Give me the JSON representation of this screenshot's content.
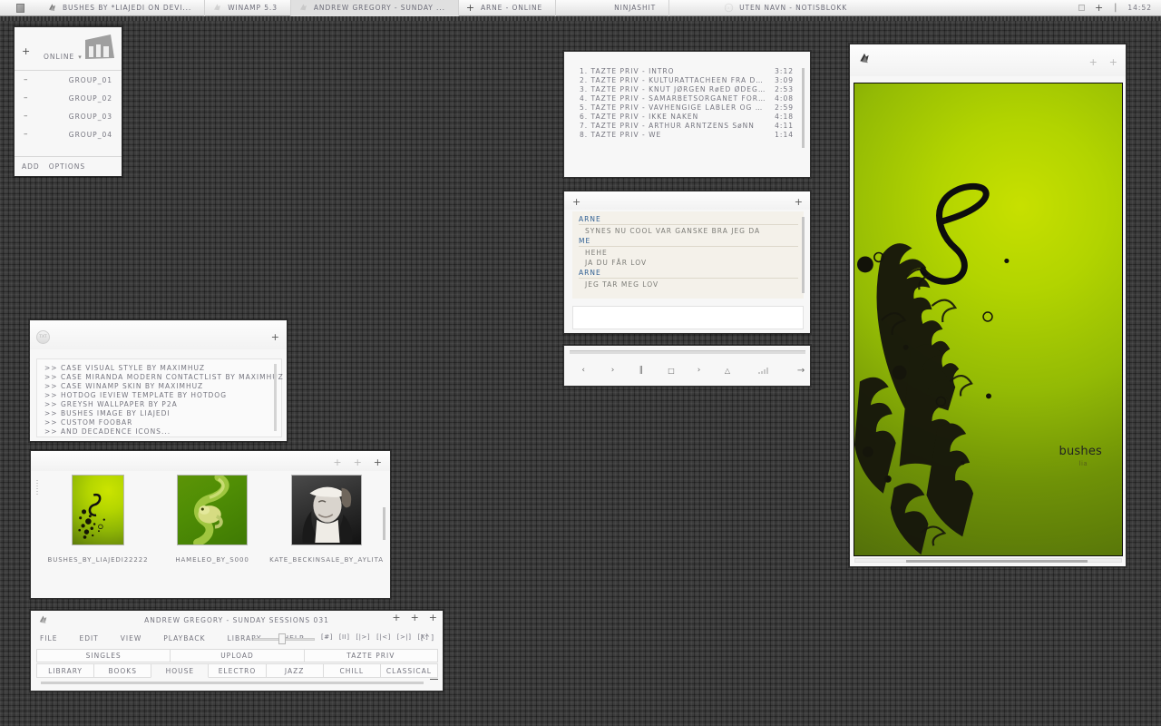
{
  "taskbar": {
    "start_icon": "start-square-icon",
    "items": [
      {
        "label": "BUSHES BY *LIAJEDI ON DEVI...",
        "icon": "foobar-icon",
        "active": false
      },
      {
        "label": "WINAMP 5.3",
        "icon": "foobar-icon",
        "active": false
      },
      {
        "label": "ANDREW GREGORY - SUNDAY ...",
        "icon": "foobar-icon",
        "active": true
      },
      {
        "label": "ARNE - ONLINE",
        "icon": "plus-icon",
        "active": false
      },
      {
        "label": "NINJASHIT",
        "icon": "none",
        "active": false
      },
      {
        "label": "UTEN NAVN - NOTISBLOKK",
        "icon": "notepad-icon",
        "active": false
      }
    ],
    "tray": {
      "box": "tray-box-icon",
      "plus": "+",
      "bar": "|",
      "clock": "14:52"
    }
  },
  "contactlist": {
    "add_icon": "+",
    "status": "ONLINE",
    "status_chevron": "chevron-down-icon",
    "avatar": "contact-avatar",
    "groups": [
      {
        "collapse": "–",
        "label": "GROUP_01"
      },
      {
        "collapse": "–",
        "label": "GROUP_02"
      },
      {
        "collapse": "–",
        "label": "GROUP_03"
      },
      {
        "collapse": "–",
        "label": "GROUP_04"
      }
    ],
    "footer": {
      "add": "ADD",
      "options": "OPTIONS"
    }
  },
  "playlist": {
    "tracks": [
      {
        "n": "1.",
        "title": "TAZTE PRIV - INTRO",
        "dur": "3:12"
      },
      {
        "n": "2.",
        "title": "TAZTE PRIV - KULTURATTACHEEN FRA DEN DANSKE ...",
        "dur": "3:09"
      },
      {
        "n": "3.",
        "title": "TAZTE PRIV - KNUT JØRGEN RøED ØDEGAARD",
        "dur": "2:53"
      },
      {
        "n": "4.",
        "title": "TAZTE PRIV - SAMARBETSORGANET FOR INVANDRAR...",
        "dur": "4:08"
      },
      {
        "n": "5.",
        "title": "TAZTE PRIV - VAVHENGIGE LABLER OG PLATESELSK...",
        "dur": "2:59"
      },
      {
        "n": "6.",
        "title": "TAZTE PRIV - IKKE NAKEN",
        "dur": "4:18"
      },
      {
        "n": "7.",
        "title": "TAZTE PRIV - ARTHUR ARNTZENS SøNN",
        "dur": "4:11"
      },
      {
        "n": "8.",
        "title": "TAZTE PRIV - WE",
        "dur": "1:14"
      }
    ]
  },
  "chat": {
    "left_plus": "+",
    "right_plus": "+",
    "messages": [
      {
        "nick": "ARNE",
        "lines": [
          "SYNES NU COOL VAR GANSKE BRA JEG DA"
        ]
      },
      {
        "nick": "ME",
        "lines": [
          "HEHE",
          "JA DU FÅR LOV"
        ]
      },
      {
        "nick": "ARNE",
        "lines": [
          "JEG TAR MEG LOV"
        ]
      }
    ],
    "input_value": "",
    "input_placeholder": ""
  },
  "transport": {
    "buttons": [
      {
        "glyph": "‹",
        "name": "previous-button"
      },
      {
        "glyph": "›",
        "name": "next-button"
      },
      {
        "glyph": "‖",
        "name": "pause-button"
      },
      {
        "glyph": "□",
        "name": "stop-button"
      },
      {
        "glyph": "›",
        "name": "play-button"
      },
      {
        "glyph": "△",
        "name": "eject-button"
      }
    ],
    "volume_label": "volume-meter",
    "arrow": "→"
  },
  "notepad": {
    "badge": "TXT",
    "plus": "+",
    "lines": [
      ">> CASE VISUAL STYLE BY MAXIMHUZ",
      ">> CASE MIRANDA MODERN CONTACTLIST BY MAXIMHUZ",
      ">> CASE WINAMP SKIN BY MAXIMHUZ",
      ">> HOTDOG IEVIEW TEMPLATE BY HOTDOG",
      ">> GREYSH WALLPAPER BY P2A",
      ">> BUSHES IMAGE BY LIAJEDI",
      ">> CUSTOM FOOBAR",
      ">> AND DECADENCE ICONS..."
    ]
  },
  "gallery": {
    "controls": [
      "+",
      "+",
      "+"
    ],
    "items": [
      {
        "caption": "BUSHES_BY_LIAJEDI22222",
        "thumb": "bushes-thumbnail"
      },
      {
        "caption": "HAMELEO_BY_S000",
        "thumb": "chameleon-thumbnail"
      },
      {
        "caption": "KATE_BECKINSALE_BY_AYLITA",
        "thumb": "portrait-thumbnail"
      }
    ]
  },
  "foobar": {
    "title": "ANDREW GREGORY - SUNDAY SESSIONS 031",
    "icon": "foobar-icon",
    "window_controls": [
      "+",
      "+",
      "+"
    ],
    "menu": [
      "FILE",
      "EDIT",
      "VIEW",
      "PLAYBACK",
      "LIBRARY",
      "HELP"
    ],
    "bracket_buttons": [
      "[#]",
      "[II]",
      "[|>]",
      "[|<]",
      "[>|]",
      "[X]"
    ],
    "last_bracket": "[^]",
    "tabs_top": [
      "SINGLES",
      "UPLOAD",
      "TAZTE PRIV"
    ],
    "tabs_bottom": [
      "LIBRARY",
      "BOOKS",
      "HOUSE",
      "ELECTRO",
      "JAZZ",
      "CHILL",
      "CLASSICAL"
    ],
    "tab_bottom_selected": "HOUSE"
  },
  "viewer": {
    "icon": "foobar-icon",
    "controls": [
      "+",
      "+"
    ],
    "watermark_main": "bushes",
    "watermark_sub": "lia"
  },
  "colors": {
    "desktop": "#3b3b3b",
    "window_bg": "#f7f7f7",
    "window_border": "#2e2e2e",
    "text": "#75757f",
    "chat_nick": "#2f5f93",
    "chat_bg": "#f4f1ea",
    "accent_green_light": "#c7e000",
    "accent_green_dark": "#53700a"
  }
}
